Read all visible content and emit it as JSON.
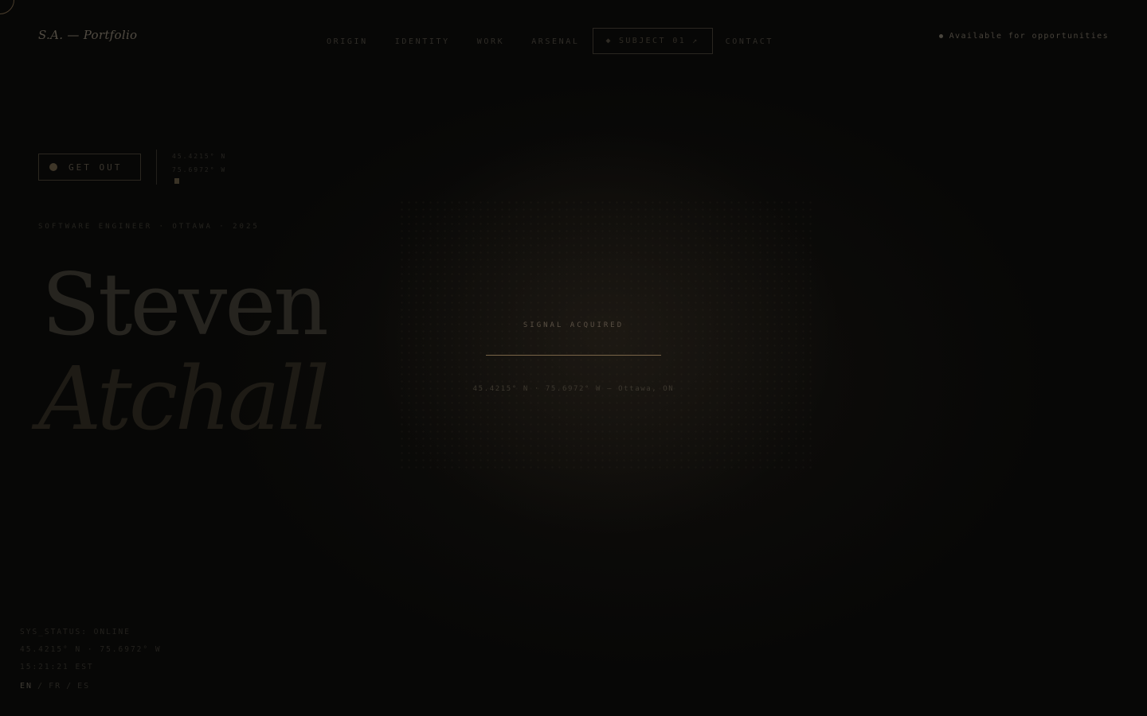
{
  "header": {
    "logo": "S.A. — Portfolio",
    "nav": [
      "ORIGIN",
      "IDENTITY",
      "WORK",
      "ARSENAL"
    ],
    "subject_button": "SUBJECT 01",
    "subject_prefix_icon": "diamond-icon",
    "subject_suffix_icon": "arrow-up-right-icon",
    "contact": "CONTACT",
    "availability": "Available for opportunities"
  },
  "hero": {
    "get_out": "GET OUT",
    "coord_lat": "45.4215° N",
    "coord_lon": "75.6972° W",
    "tagline": "SOFTWARE ENGINEER · OTTAWA · 2025",
    "first_name": "Steven",
    "last_name": "Atchall"
  },
  "signal": {
    "label": "SIGNAL ACQUIRED",
    "coords": "45.4215° N · 75.6972° W — Ottawa, ON"
  },
  "status": {
    "sys": "SYS_STATUS: ONLINE",
    "coords": "45.4215° N · 75.6972° W",
    "time": "15:21:21 EST"
  },
  "languages": [
    "EN",
    "FR",
    "ES"
  ],
  "colors": {
    "background": "#070706",
    "accent": "#7a6548"
  }
}
